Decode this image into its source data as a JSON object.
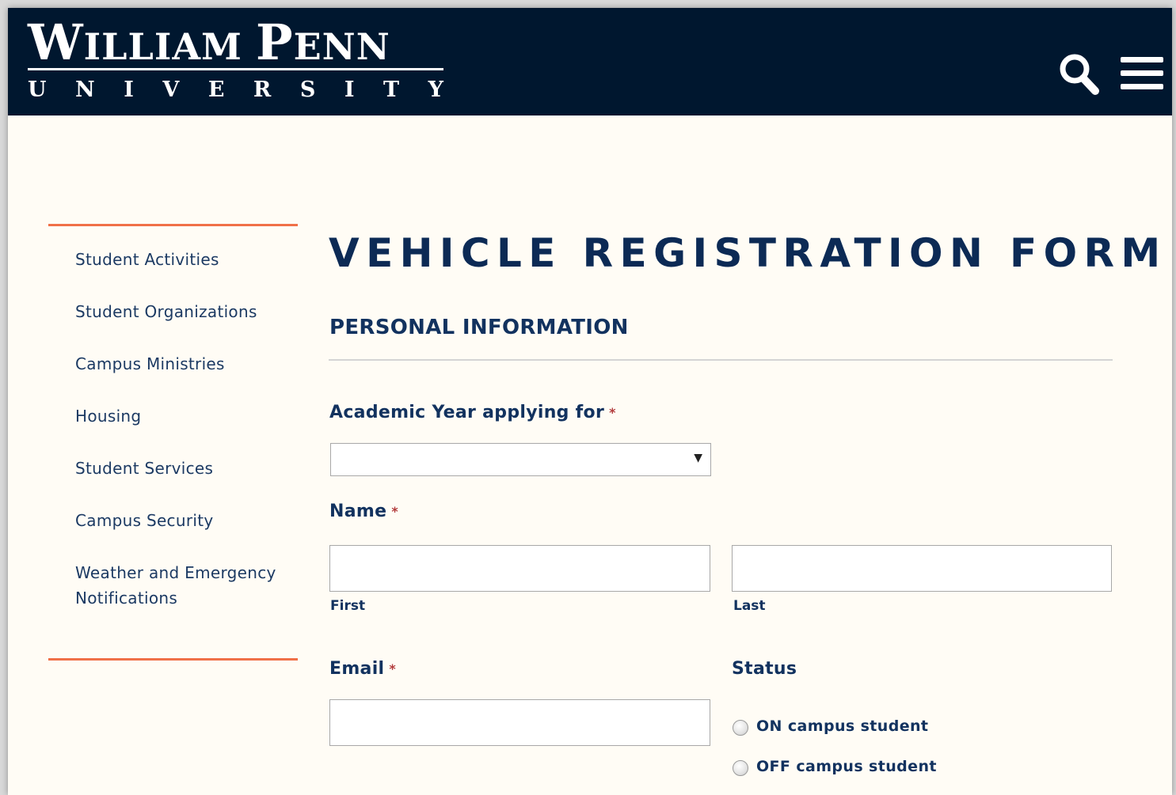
{
  "brand": {
    "name_line1_W": "W",
    "name_line1_rest": "ILLIAM",
    "name_line1_P": "P",
    "name_line1_rest2": "ENN",
    "name_line2_letters": [
      "U",
      "N",
      "I",
      "V",
      "E",
      "R",
      "S",
      "I",
      "T",
      "Y"
    ]
  },
  "header": {
    "search_icon": "search-icon",
    "menu_icon": "hamburger-menu-icon",
    "background_color": "#00172f"
  },
  "sidebar": {
    "accent_color": "#f07048",
    "items": [
      {
        "label": "Student Activities"
      },
      {
        "label": "Student Organizations"
      },
      {
        "label": "Campus Ministries"
      },
      {
        "label": "Housing"
      },
      {
        "label": "Student Services"
      },
      {
        "label": "Campus Security"
      },
      {
        "label": "Weather and Emergency",
        "label2": "Notifications"
      }
    ]
  },
  "form": {
    "title": "VEHICLE REGISTRATION FORM",
    "section_title": "PERSONAL INFORMATION",
    "required_mark": "*",
    "academic_year": {
      "label": "Academic Year applying for",
      "selected_value": ""
    },
    "name": {
      "label": "Name",
      "first_label": "First",
      "last_label": "Last",
      "first_value": "",
      "last_value": ""
    },
    "email": {
      "label": "Email",
      "value": ""
    },
    "status": {
      "label": "Status",
      "options": [
        {
          "label": "ON campus student",
          "checked": false
        },
        {
          "label": "OFF campus student",
          "checked": false
        }
      ]
    }
  }
}
